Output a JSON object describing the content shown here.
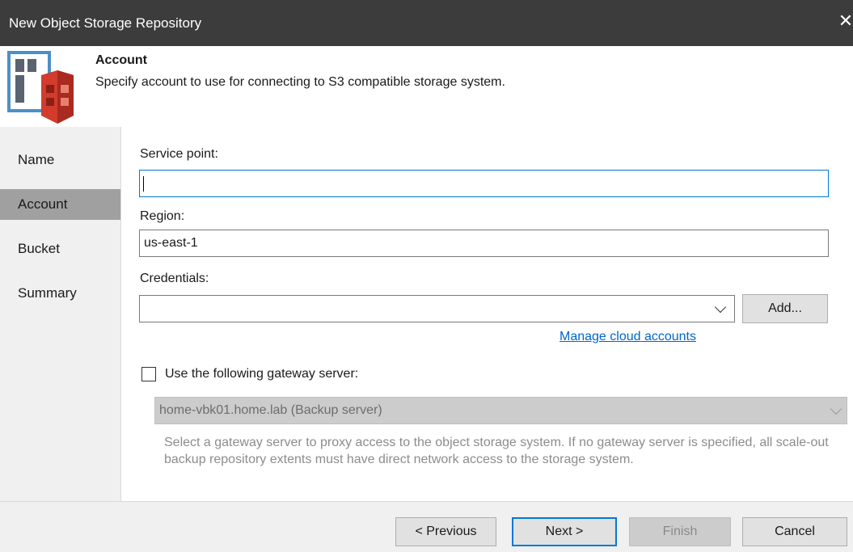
{
  "window": {
    "title": "New Object Storage Repository",
    "close_symbol": "✕"
  },
  "header": {
    "title": "Account",
    "subtitle": "Specify account to use for connecting to S3 compatible storage system.",
    "icon": "object-storage-repository-icon",
    "icon_colors": {
      "server": "#4a90c8",
      "bucket": "#d13c2c"
    }
  },
  "sidebar": {
    "items": [
      {
        "label": "Name",
        "active": false
      },
      {
        "label": "Account",
        "active": true
      },
      {
        "label": "Bucket",
        "active": false
      },
      {
        "label": "Summary",
        "active": false
      }
    ]
  },
  "form": {
    "service_point": {
      "label": "Service point:",
      "value": ""
    },
    "region": {
      "label": "Region:",
      "value": "us-east-1"
    },
    "credentials": {
      "label": "Credentials:",
      "value": "",
      "add_label": "Add..."
    },
    "manage_link": "Manage cloud accounts",
    "gateway": {
      "checkbox_label": "Use the following gateway server:",
      "checked": false,
      "server_value": "home-vbk01.home.lab (Backup server)",
      "description": "Select a gateway server to proxy access to the object storage system. If no gateway server is specified, all scale-out backup repository extents must have direct network access to the storage system."
    }
  },
  "footer": {
    "previous_label": "< Previous",
    "next_label": "Next >",
    "finish_label": "Finish",
    "cancel_label": "Cancel"
  },
  "colors": {
    "titlebar": "#3c3c3c",
    "accent": "#0078d7",
    "link": "#0066cc",
    "sidebar_active": "#a0a0a0"
  }
}
